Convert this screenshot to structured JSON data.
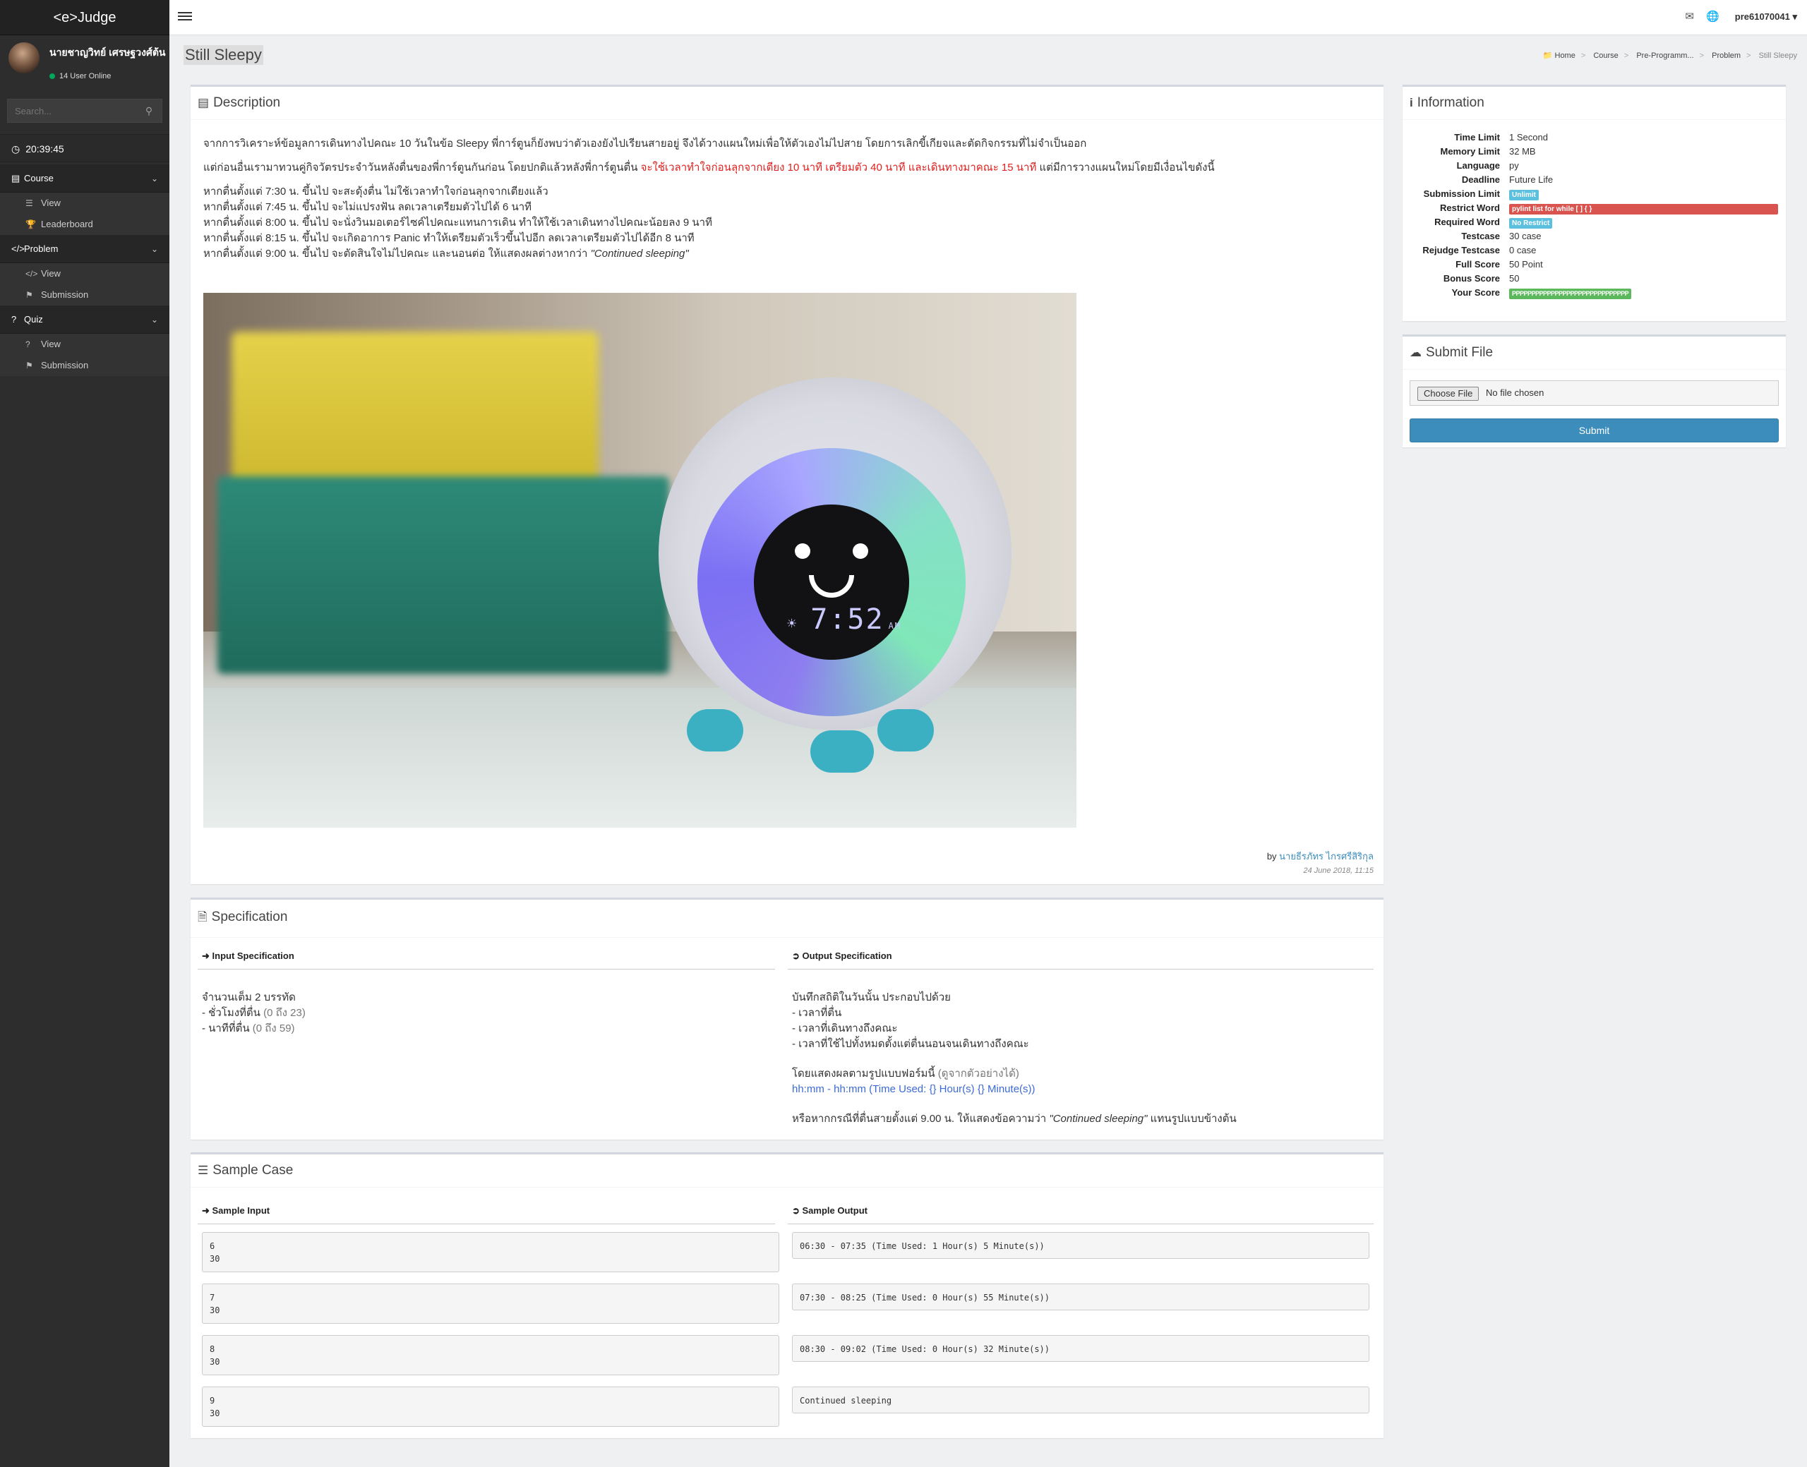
{
  "sidebar": {
    "brand": "<e>Judge",
    "user_name": "นายชาญวิทย์ เศรษฐวงศ์ต้น",
    "online_text": "14 User Online",
    "search_placeholder": "Search...",
    "clock": "20:39:45",
    "menu": {
      "course": {
        "label": "Course",
        "items": [
          "View",
          "Leaderboard"
        ]
      },
      "problem": {
        "label": "Problem",
        "items": [
          "View",
          "Submission"
        ]
      },
      "quiz": {
        "label": "Quiz",
        "items": [
          "View",
          "Submission"
        ]
      }
    }
  },
  "topbar": {
    "user": "pre61070041"
  },
  "page": {
    "title": "Still Sleepy"
  },
  "breadcrumb": [
    "Home",
    "Course",
    "Pre-Programm...",
    "Problem",
    "Still Sleepy"
  ],
  "description": {
    "title": "Description",
    "p1": "จากการวิเคราะห์ข้อมูลการเดินทางไปคณะ 10 วันในข้อ Sleepy พี่การ์ตูนก็ยังพบว่าตัวเองยังไปเรียนสายอยู่ จึงได้วางแผนใหม่เพื่อให้ตัวเองไม่ไปสาย โดยการเลิกขี้เกียจและตัดกิจกรรมที่ไม่จำเป็นออก",
    "p2_start": "แต่ก่อนอื่นเรามาทวนคู่กิจวัตรประจำวันหลังตื่นของพี่การ์ตูนกันก่อน โดยปกติแล้วหลังพี่การ์ตูนตื่น ",
    "p2_red": "จะใช้เวลาทำใจก่อนลุกจากเตียง 10 นาที เตรียมตัว 40 นาที และเดินทางมาคณะ 15 นาที",
    "p2_end": " แต่มีการวางแผนใหม่โดยมีเงื่อนไขดังนี้",
    "lines": [
      "หากตื่นตั้งแต่ 7:30 น. ขึ้นไป จะสะดุ้งตื่น ไม่ใช้เวลาทำใจก่อนลุกจากเตียงแล้ว",
      "หากตื่นตั้งแต่ 7:45 น. ขึ้นไป จะไม่แปรงฟัน ลดเวลาเตรียมตัวไปได้ 6 นาที",
      "หากตื่นตั้งแต่ 8:00 น. ขึ้นไป จะนั่งวินมอเตอร์ไซค์ไปคณะแทนการเดิน ทำให้ใช้เวลาเดินทางไปคณะน้อยลง 9 นาที",
      "หากตื่นตั้งแต่ 8:15 น. ขึ้นไป จะเกิดอาการ Panic ทำให้เตรียมตัวเร็วขึ้นไปอีก ลดเวลาเตรียมตัวไปได้อีก 8 นาที"
    ],
    "last_line": "หากตื่นตั้งแต่ 9:00 น. ขึ้นไป จะตัดสินใจไม่ไปคณะ และนอนต่อ ให้แสดงผลต่างหากว่า ",
    "last_line_em": "\"Continued sleeping\"",
    "clock_time": "7:52",
    "clock_ampm": "AM",
    "author_prefix": "by ",
    "author": "นายธีรภัทร ไกรศรีสิริกุล",
    "date": "24 June 2018, 11:15"
  },
  "specification": {
    "title": "Specification",
    "input_head": "Input Specification",
    "output_head": "Output Specification",
    "input_line1": "จำนวนเต็ม 2 บรรทัด",
    "input_line2": "- ชั่วโมงที่ตื่น ",
    "input_line2_gray": "(0 ถึง 23)",
    "input_line3": "- นาทีที่ตื่น ",
    "input_line3_gray": "(0 ถึง 59)",
    "output_lines": [
      "บันทึกสถิติในวันนั้น ประกอบไปด้วย",
      "- เวลาที่ตื่น",
      "- เวลาที่เดินทางถึงคณะ",
      "- เวลาที่ใช้ไปทั้งหมดตั้งแต่ตื่นนอนจนเดินทางถึงคณะ"
    ],
    "format_line": "โดยแสดงผลตามรูปแบบฟอร์มนี้ ",
    "format_line_gray": "(ดูจากตัวอย่างได้)",
    "format": "hh:mm - hh:mm (Time Used: {} Hour(s) {} Minute(s))",
    "else_line": "หรือหากกรณีที่ตื่นสายตั้งแต่ 9.00 น. ให้แสดงข้อความว่า ",
    "else_em": "\"Continued sleeping\"",
    "else_end": " แทนรูปแบบข้างต้น"
  },
  "sample": {
    "title": "Sample Case",
    "input_head": "Sample Input",
    "output_head": "Sample Output",
    "inputs": [
      "6\n30",
      "7\n30",
      "8\n30",
      "9\n30"
    ],
    "outputs": [
      "06:30 - 07:35 (Time Used: 1 Hour(s) 5 Minute(s))",
      "07:30 - 08:25 (Time Used: 0 Hour(s) 55 Minute(s))",
      "08:30 - 09:02 (Time Used: 0 Hour(s) 32 Minute(s))",
      "Continued sleeping"
    ]
  },
  "information": {
    "title": "Information",
    "rows": [
      {
        "k": "Time Limit",
        "v": "1 Second"
      },
      {
        "k": "Memory Limit",
        "v": "32 MB"
      },
      {
        "k": "Language",
        "v": "py"
      },
      {
        "k": "Deadline",
        "v": "Future Life"
      }
    ],
    "submission_limit_k": "Submission Limit",
    "submission_limit_v": "Unlimit",
    "restrict_k": "Restrict Word",
    "restrict_v": "pylint list for while [ ] { }",
    "required_k": "Required Word",
    "required_v": "No Restrict",
    "rows2": [
      {
        "k": "Testcase",
        "v": "30 case"
      },
      {
        "k": "Rejudge Testcase",
        "v": "0 case"
      },
      {
        "k": "Full Score",
        "v": "50 Point"
      },
      {
        "k": "Bonus Score",
        "v": "50"
      }
    ],
    "score_k": "Your Score",
    "score_v": "PPPPPPPPPPPPPPPPPPPPPPPPPPPPPP",
    "colors": {
      "unlimit": "#5bc0de",
      "restrict": "#d9534f",
      "required": "#5bc0de",
      "score": "#5cb85c"
    }
  },
  "submit_file": {
    "title": "Submit File",
    "choose": "Choose File",
    "no_file": "No file chosen",
    "submit": "Submit"
  }
}
